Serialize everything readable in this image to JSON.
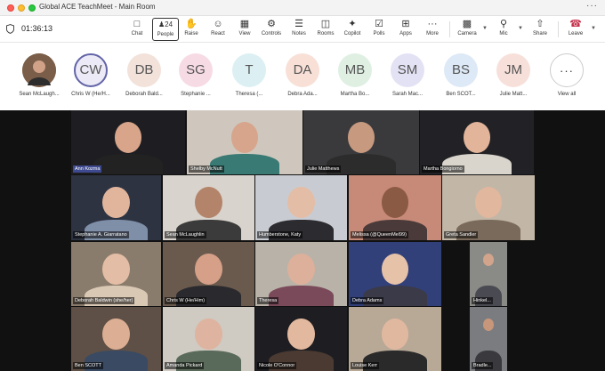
{
  "window": {
    "title": "Global ACE TeachMeet - Main Room",
    "more": "···"
  },
  "toolbar": {
    "timer": "01:36:13",
    "people_count": "24",
    "buttons": [
      {
        "label": "Chat",
        "icon": "chat-icon"
      },
      {
        "label": "People",
        "icon": "people-icon"
      },
      {
        "label": "Raise",
        "icon": "hand-icon"
      },
      {
        "label": "React",
        "icon": "smiley-icon"
      },
      {
        "label": "View",
        "icon": "grid-icon"
      },
      {
        "label": "Controls",
        "icon": "controls-icon"
      },
      {
        "label": "Notes",
        "icon": "notes-icon"
      },
      {
        "label": "Rooms",
        "icon": "rooms-icon"
      },
      {
        "label": "Copilot",
        "icon": "copilot-icon"
      },
      {
        "label": "Polls",
        "icon": "polls-icon"
      },
      {
        "label": "Apps",
        "icon": "apps-icon"
      },
      {
        "label": "More",
        "icon": "more-icon"
      },
      {
        "label": "Camera",
        "icon": "camera-icon"
      },
      {
        "label": "Mic",
        "icon": "mic-icon"
      },
      {
        "label": "Share",
        "icon": "share-icon"
      },
      {
        "label": "Leave",
        "icon": "phone-icon"
      }
    ]
  },
  "people_strip": [
    {
      "initials": "",
      "name": "Sean McLaugh...",
      "color": "#a07a5a"
    },
    {
      "initials": "CW",
      "name": "Chris W (He/H...",
      "color": "#eceaf6"
    },
    {
      "initials": "DB",
      "name": "Deborah Bald...",
      "color": "#f2e2da"
    },
    {
      "initials": "SG",
      "name": "Stephanie ...",
      "color": "#f7dbe4"
    },
    {
      "initials": "T",
      "name": "Theresa (...",
      "color": "#dcf0f3"
    },
    {
      "initials": "DA",
      "name": "Debra Ada...",
      "color": "#f8e0d7"
    },
    {
      "initials": "MB",
      "name": "Martha Bo...",
      "color": "#dff0e3"
    },
    {
      "initials": "SM",
      "name": "Sarah Mac...",
      "color": "#e3e2f4"
    },
    {
      "initials": "BS",
      "name": "Ben SCOT...",
      "color": "#dde9f6"
    },
    {
      "initials": "JM",
      "name": "Julie Matt...",
      "color": "#f7e0da"
    },
    {
      "initials": "···",
      "name": "View all",
      "color": "#ffffff"
    }
  ],
  "tiles": [
    {
      "name": "Ann Kozma",
      "bg": "#1e1e22",
      "skin": "#d8a58a",
      "shirt": "#222222",
      "highlight": true
    },
    {
      "name": "Shelby McNutt",
      "bg": "#cfc7bd",
      "skin": "#d6a58c",
      "shirt": "#3a7a74"
    },
    {
      "name": "Julie Matthews",
      "bg": "#3a3a3c",
      "skin": "#c79a80",
      "shirt": "#2c2c2c"
    },
    {
      "name": "Martha Bongiorno",
      "bg": "#222226",
      "skin": "#e2b49a",
      "shirt": "#d9d4cc"
    },
    {
      "name": "Stephanie A. Giarratano",
      "bg": "#2e3342",
      "skin": "#e0b59c",
      "shirt": "#7f8fa8"
    },
    {
      "name": "Sean McLaughlin",
      "bg": "#d8d3cc",
      "skin": "#b4846a",
      "shirt": "#3b3b3b"
    },
    {
      "name": "Humberstone, Katy",
      "bg": "#c8ccd2",
      "skin": "#e4bda6",
      "shirt": "#2b2b30"
    },
    {
      "name": "Melissa (@QueenMel99)",
      "bg": "#c88a78",
      "skin": "#8a5a44",
      "shirt": "#4a3a3a"
    },
    {
      "name": "Greta Sandler",
      "bg": "#c2b6a6",
      "skin": "#e1b79e",
      "shirt": "#7a6a5c"
    },
    {
      "name": "Deborah Baldwin (she/her)",
      "bg": "#8a7c6c",
      "skin": "#e4bda6",
      "shirt": "#d9c8b4"
    },
    {
      "name": "Chris W (He/Him)",
      "bg": "#6a5a4e",
      "skin": "#d6a088",
      "shirt": "#2a2a2e"
    },
    {
      "name": "Theresa",
      "bg": "#b9b2a8",
      "skin": "#dcb09a",
      "shirt": "#7a4a5a"
    },
    {
      "name": "Debra Adams",
      "bg": "#32407a",
      "skin": "#e6c2a8",
      "shirt": "#3a3a48"
    },
    {
      "name": "Hinkel...",
      "bg": "#8a8a86",
      "skin": "#d2a48c",
      "shirt": "#4a4a52"
    },
    {
      "name": "Ben SCOTT",
      "bg": "#5e5046",
      "skin": "#dcae94",
      "shirt": "#3a4a62"
    },
    {
      "name": "Amanda Pickard",
      "bg": "#cfcac2",
      "skin": "#deb4a0",
      "shirt": "#5a6a5a"
    },
    {
      "name": "Nicole O'Connor",
      "bg": "#1e1e22",
      "skin": "#e2b89e",
      "shirt": "#4a3a32"
    },
    {
      "name": "Louise Kerr",
      "bg": "#b8a896",
      "skin": "#e0b8a0",
      "shirt": "#2a2a2a"
    },
    {
      "name": "Bradle...",
      "bg": "#7a7c80",
      "skin": "#c8967a",
      "shirt": "#3a3a3e"
    }
  ]
}
